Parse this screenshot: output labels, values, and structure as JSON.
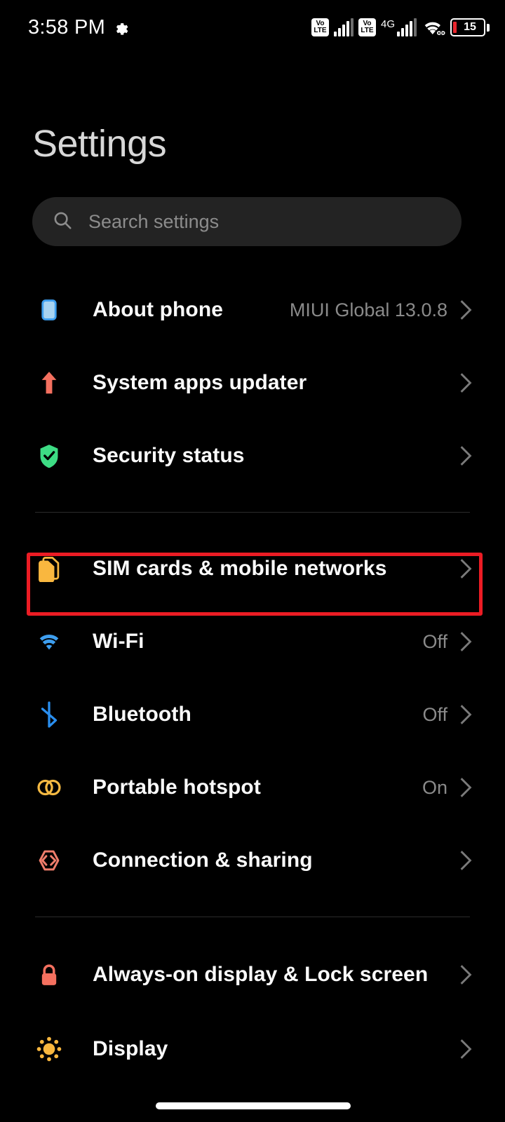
{
  "statusbar": {
    "time": "3:58 PM",
    "gear_icon": "gear-icon",
    "volte1": {
      "top": "Vo",
      "bottom": "LTE"
    },
    "volte2": {
      "top": "Vo",
      "bottom": "LTE"
    },
    "network_type": "4G",
    "wifi_icon": "wifi-link-icon",
    "battery_percent": "15"
  },
  "header": {
    "title": "Settings"
  },
  "search": {
    "placeholder": "Search settings",
    "icon": "search-icon"
  },
  "groups": [
    {
      "items": [
        {
          "label": "About phone",
          "value": "MIUI Global 13.0.8",
          "icon": "phone-icon",
          "color": "#a8d3f0"
        },
        {
          "label": "System apps updater",
          "value": "",
          "icon": "up-arrow-icon",
          "color": "#f4705f"
        },
        {
          "label": "Security status",
          "value": "",
          "icon": "shield-check-icon",
          "color": "#3ddc84"
        }
      ]
    },
    {
      "items": [
        {
          "label": "SIM cards & mobile networks",
          "value": "",
          "icon": "sim-card-icon",
          "color": "#f9b73f",
          "highlighted": true
        },
        {
          "label": "Wi-Fi",
          "value": "Off",
          "icon": "wifi-icon",
          "color": "#3e9ff0"
        },
        {
          "label": "Bluetooth",
          "value": "Off",
          "icon": "bluetooth-icon",
          "color": "#2a8ff0"
        },
        {
          "label": "Portable hotspot",
          "value": "On",
          "icon": "hotspot-icon",
          "color": "#f4b942"
        },
        {
          "label": "Connection & sharing",
          "value": "",
          "icon": "connection-sharing-icon",
          "color": "#ef7d6b"
        }
      ]
    },
    {
      "items": [
        {
          "label": "Always-on display & Lock screen",
          "value": "",
          "icon": "lock-icon",
          "color": "#f4705f"
        },
        {
          "label": "Display",
          "value": "",
          "icon": "brightness-icon",
          "color": "#f9b73f"
        }
      ]
    }
  ],
  "colors": {
    "background": "#000000",
    "highlight_border": "#ec1c24",
    "search_bg": "#232323",
    "label": "#fafafa",
    "value": "#8a8a8a",
    "title": "#d8d8d8",
    "divider": "#2b2b2b"
  },
  "navigation": {
    "home_indicator": "home-gesture-bar"
  }
}
